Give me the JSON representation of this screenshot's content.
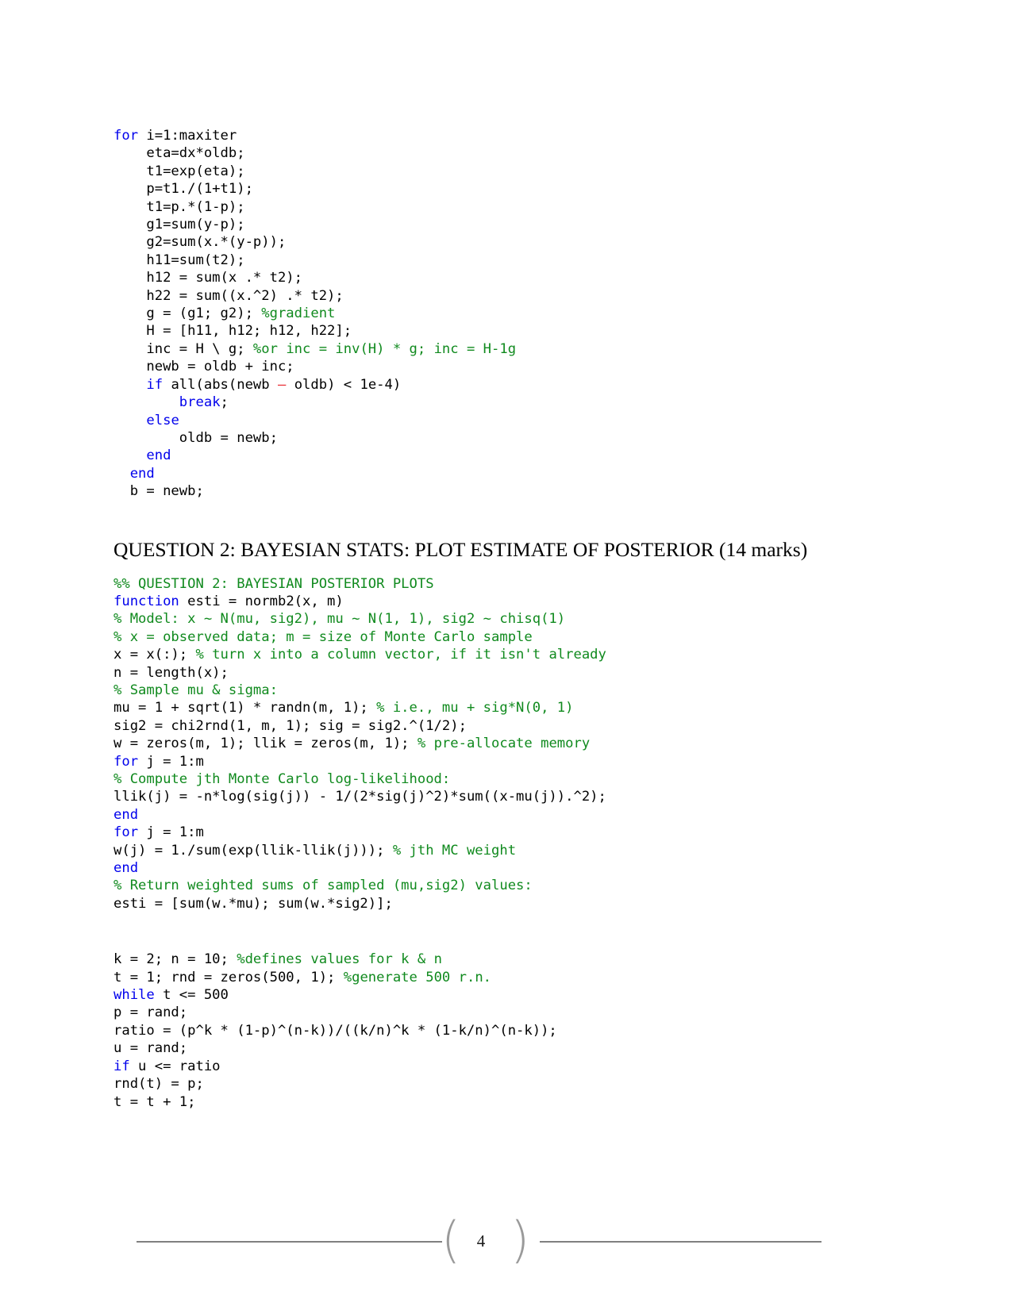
{
  "document": {
    "page_number": "4"
  },
  "code_block_1": {
    "name": "newton-raphson-loop",
    "lines": [
      [
        {
          "t": "for",
          "c": "kw"
        },
        {
          "t": " i=1:maxiter",
          "c": "plain"
        }
      ],
      [
        {
          "t": "    eta=dx*oldb;",
          "c": "plain"
        }
      ],
      [
        {
          "t": "    t1=exp(eta);",
          "c": "plain"
        }
      ],
      [
        {
          "t": "    p=t1./(1+t1);",
          "c": "plain"
        }
      ],
      [
        {
          "t": "    t1=p.*(1-p);",
          "c": "plain"
        }
      ],
      [
        {
          "t": "    g1=sum(y-p);",
          "c": "plain"
        }
      ],
      [
        {
          "t": "    g2=sum(x.*(y-p));",
          "c": "plain"
        }
      ],
      [
        {
          "t": "    h11=sum(t2);",
          "c": "plain"
        }
      ],
      [
        {
          "t": "    h12 = sum(x .* t2);",
          "c": "plain"
        }
      ],
      [
        {
          "t": "    h22 = sum((x.^2) .* t2);",
          "c": "plain"
        }
      ],
      [
        {
          "t": "    g = (g1; g2); ",
          "c": "plain"
        },
        {
          "t": "%gradient",
          "c": "cm"
        }
      ],
      [
        {
          "t": "    H = [h11, h12; h12, h22];",
          "c": "plain"
        }
      ],
      [
        {
          "t": "    inc = H \\ g; ",
          "c": "plain"
        },
        {
          "t": "%or inc = inv(H) * g; inc = H-1g",
          "c": "cm"
        }
      ],
      [
        {
          "t": "    newb = oldb + inc;",
          "c": "plain"
        }
      ],
      [
        {
          "t": "    ",
          "c": "plain"
        },
        {
          "t": "if",
          "c": "kw"
        },
        {
          "t": " all(abs(newb ",
          "c": "plain"
        },
        {
          "t": "–",
          "c": "op-red"
        },
        {
          "t": " oldb) < 1e-4)",
          "c": "plain"
        }
      ],
      [
        {
          "t": "        ",
          "c": "plain"
        },
        {
          "t": "break",
          "c": "kw"
        },
        {
          "t": ";",
          "c": "plain"
        }
      ],
      [
        {
          "t": "    ",
          "c": "plain"
        },
        {
          "t": "else",
          "c": "kw"
        }
      ],
      [
        {
          "t": "        oldb = newb;",
          "c": "plain"
        }
      ],
      [
        {
          "t": "    ",
          "c": "plain"
        },
        {
          "t": "end",
          "c": "kw"
        }
      ],
      [
        {
          "t": "  ",
          "c": "plain"
        },
        {
          "t": "end",
          "c": "kw"
        }
      ],
      [
        {
          "t": "  b = newb;",
          "c": "plain"
        }
      ]
    ]
  },
  "heading_q2": {
    "text": "QUESTION 2: BAYESIAN STATS: PLOT ESTIMATE OF POSTERIOR (14 marks)"
  },
  "code_block_2": {
    "name": "bayesian-posterior-function",
    "lines": [
      [
        {
          "t": "%% QUESTION 2: BAYESIAN POSTERIOR PLOTS",
          "c": "cm"
        }
      ],
      [
        {
          "t": "function",
          "c": "kw"
        },
        {
          "t": " esti = normb2(x, m)",
          "c": "plain"
        }
      ],
      [
        {
          "t": "% Model: x ~ N(mu, sig2), mu ~ N(1, 1), sig2 ~ chisq(1)",
          "c": "cm"
        }
      ],
      [
        {
          "t": "% x = observed data; m = size of Monte Carlo sample",
          "c": "cm"
        }
      ],
      [
        {
          "t": "x = x(:); ",
          "c": "plain"
        },
        {
          "t": "% turn x into a column vector, if it isn't already",
          "c": "cm"
        }
      ],
      [
        {
          "t": "n = length(x);",
          "c": "plain"
        }
      ],
      [
        {
          "t": "% Sample mu & sigma:",
          "c": "cm"
        }
      ],
      [
        {
          "t": "mu = 1 + sqrt(1) * randn(m, 1); ",
          "c": "plain"
        },
        {
          "t": "% i.e., mu + sig*N(0, 1)",
          "c": "cm"
        }
      ],
      [
        {
          "t": "sig2 = chi2rnd(1, m, 1); sig = sig2.^(1/2);",
          "c": "plain"
        }
      ],
      [
        {
          "t": "w = zeros(m, 1); llik = zeros(m, 1); ",
          "c": "plain"
        },
        {
          "t": "% pre-allocate memory",
          "c": "cm"
        }
      ],
      [
        {
          "t": "for",
          "c": "kw"
        },
        {
          "t": " j = 1:m",
          "c": "plain"
        }
      ],
      [
        {
          "t": "% Compute jth Monte Carlo log-likelihood:",
          "c": "cm"
        }
      ],
      [
        {
          "t": "llik(j) = -n*log(sig(j)) - 1/(2*sig(j)^2)*sum((x-mu(j)).^2);",
          "c": "plain"
        }
      ],
      [
        {
          "t": "end",
          "c": "kw"
        }
      ],
      [
        {
          "t": "for",
          "c": "kw"
        },
        {
          "t": " j = 1:m",
          "c": "plain"
        }
      ],
      [
        {
          "t": "w(j) = 1./sum(exp(llik-llik(j))); ",
          "c": "plain"
        },
        {
          "t": "% jth MC weight",
          "c": "cm"
        }
      ],
      [
        {
          "t": "end",
          "c": "kw"
        }
      ],
      [
        {
          "t": "% Return weighted sums of sampled (mu,sig2) values:",
          "c": "cm"
        }
      ],
      [
        {
          "t": "esti = [sum(w.*mu); sum(w.*sig2)];",
          "c": "plain"
        }
      ]
    ]
  },
  "code_block_3": {
    "name": "accept-reject-sampler",
    "lines": [
      [
        {
          "t": "k = 2; n = 10; ",
          "c": "plain"
        },
        {
          "t": "%defines values for k & n",
          "c": "cm"
        }
      ],
      [
        {
          "t": "t = 1; rnd = zeros(500, 1); ",
          "c": "plain"
        },
        {
          "t": "%generate 500 r.n.",
          "c": "cm"
        }
      ],
      [
        {
          "t": "while",
          "c": "kw"
        },
        {
          "t": " t <= 500",
          "c": "plain"
        }
      ],
      [
        {
          "t": "p = rand;",
          "c": "plain"
        }
      ],
      [
        {
          "t": "ratio = (p^k * (1-p)^(n-k))/((k/n)^k * (1-k/n)^(n-k));",
          "c": "plain"
        }
      ],
      [
        {
          "t": "u = rand;",
          "c": "plain"
        }
      ],
      [
        {
          "t": "if",
          "c": "kw"
        },
        {
          "t": " u <= ratio",
          "c": "plain"
        }
      ],
      [
        {
          "t": "rnd(t) = p;",
          "c": "plain"
        }
      ],
      [
        {
          "t": "t = t + 1;",
          "c": "plain"
        }
      ]
    ]
  },
  "footer": {
    "paren_left": "(",
    "paren_right": ")"
  },
  "colors": {
    "keyword": "#0000ec",
    "comment": "#108a1e",
    "operator_red": "#e8282e",
    "text": "#000000",
    "footer_rule": "#808080",
    "footer_paren": "#9a9a9a"
  }
}
